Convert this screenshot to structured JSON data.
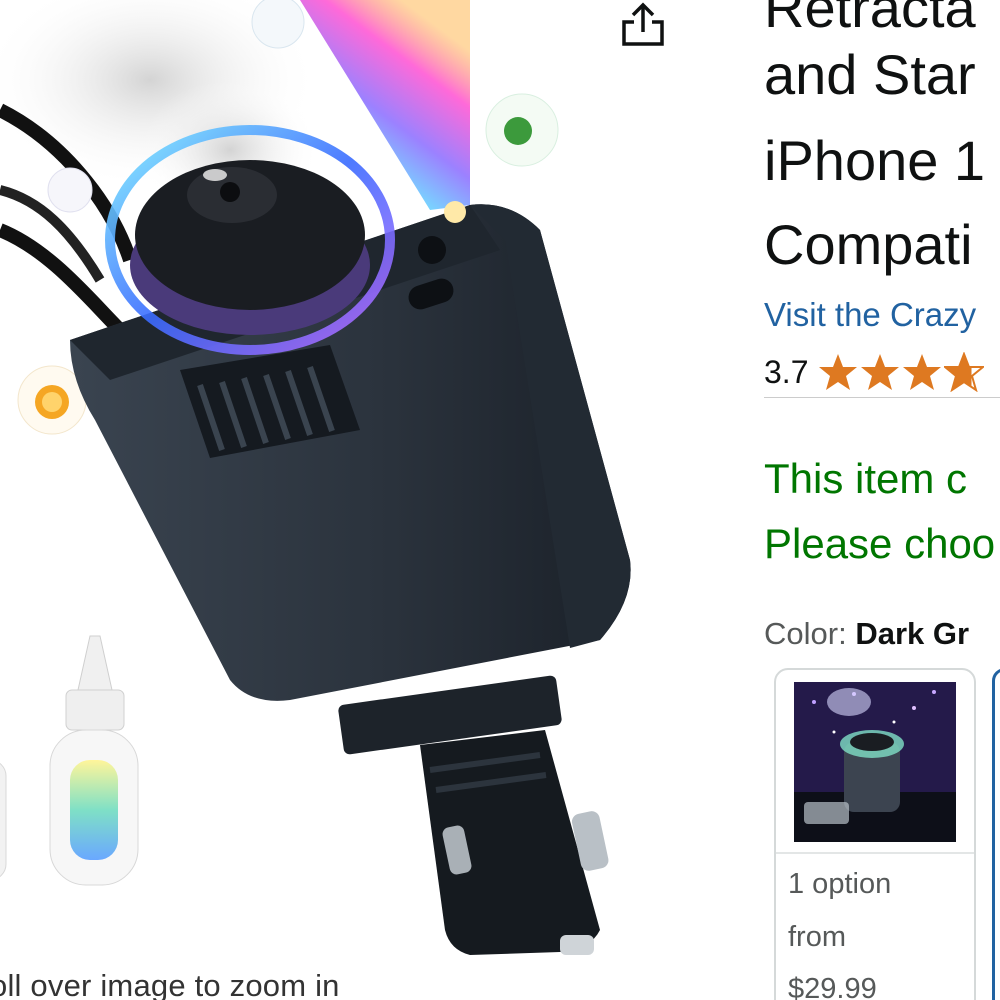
{
  "page": {
    "zoom_hint": "oll over image to zoom in"
  },
  "product": {
    "title_lines": [
      "Retracta",
      "and Star",
      "iPhone 1",
      "Compati"
    ],
    "store_link": "Visit the Crazy",
    "rating": "3.7",
    "stars": {
      "full": 3,
      "partial": 0.7,
      "count": 5
    }
  },
  "availability": {
    "line1": "This item c",
    "line2": "Please choo"
  },
  "color": {
    "label": "Color:",
    "selected": "Dark Gr"
  },
  "swatch": {
    "option_count": "1 option",
    "from_label": "from",
    "price": "$29.99"
  },
  "colors": {
    "link": "#2162a1",
    "availability": "#007600",
    "star": "#de7921",
    "device": "#2f3640"
  },
  "icons": {
    "share": "share-icon",
    "star": "star-icon"
  }
}
